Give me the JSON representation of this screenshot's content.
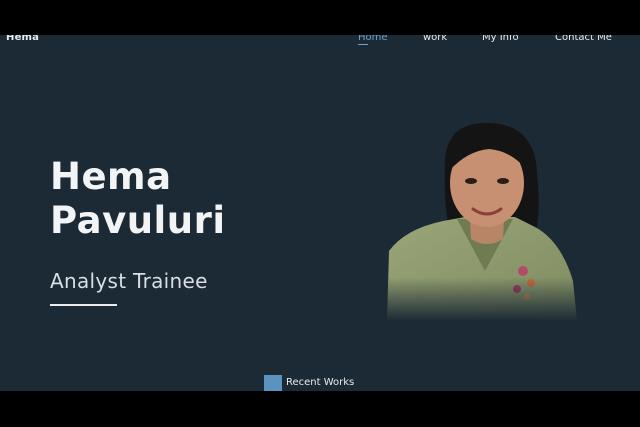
{
  "brand": "Hema",
  "nav": {
    "items": [
      {
        "label": "Home",
        "active": true
      },
      {
        "label": "work",
        "active": false
      },
      {
        "label": "My Info",
        "active": false
      },
      {
        "label": "Contact Me",
        "active": false
      }
    ]
  },
  "hero": {
    "first_name": "Hema",
    "last_name": "Pavuluri",
    "role": "Analyst Trainee"
  },
  "recent_works": {
    "label": "Recent Works"
  },
  "colors": {
    "background": "#1c2a35",
    "accent": "#6fa3c9",
    "square": "#5b93c0"
  }
}
